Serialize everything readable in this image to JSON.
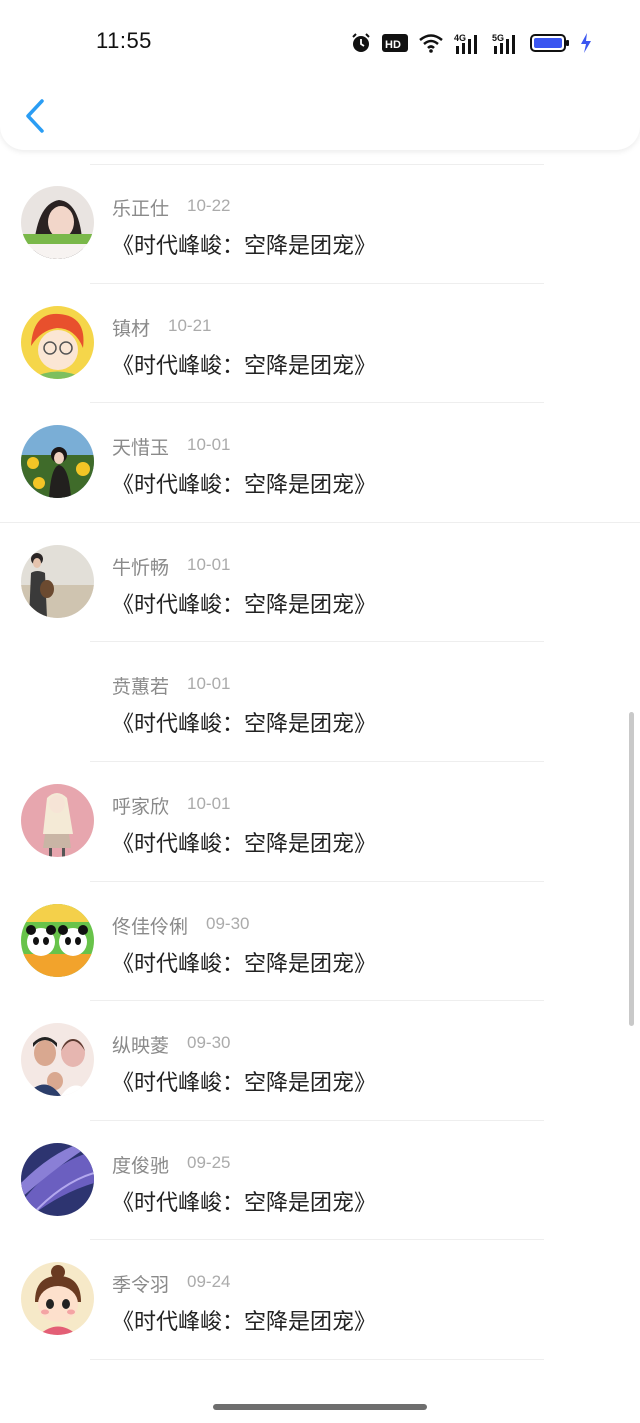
{
  "status_bar": {
    "time": "11:55",
    "icons": [
      "alarm-icon",
      "hd-icon",
      "wifi-icon",
      "signal-4g-icon",
      "signal-5g-icon",
      "battery-icon",
      "charging-icon"
    ],
    "hd_label": "HD",
    "net_4g": "4G",
    "net_5g": "5G"
  },
  "header": {
    "back_icon": "chevron-left-icon",
    "accent": "#2a9df4"
  },
  "items": [
    {
      "name": "乐正仕",
      "date": "10-22",
      "title": "《时代峰峻：空降是团宠》",
      "avatar": "avatar-girl-photo"
    },
    {
      "name": "镇材",
      "date": "10-21",
      "title": "《时代峰峻：空降是团宠》",
      "avatar": "avatar-redhair-cartoon"
    },
    {
      "name": "天惜玉",
      "date": "10-01",
      "title": "《时代峰峻：空降是团宠》",
      "avatar": "avatar-sunflower-girl"
    },
    {
      "name": "牛忻畅",
      "date": "10-01",
      "title": "《时代峰峻：空降是团宠》",
      "avatar": "avatar-beach-person"
    },
    {
      "name": "贲蕙若",
      "date": "10-01",
      "title": "《时代峰峻：空降是团宠》",
      "avatar": "avatar-empty"
    },
    {
      "name": "呼家欣",
      "date": "10-01",
      "title": "《时代峰峻：空降是团宠》",
      "avatar": "avatar-pink-drawing"
    },
    {
      "name": "佟佳伶俐",
      "date": "09-30",
      "title": "《时代峰峻：空降是团宠》",
      "avatar": "avatar-pandas"
    },
    {
      "name": "纵映菱",
      "date": "09-30",
      "title": "《时代峰峻：空降是团宠》",
      "avatar": "avatar-couple"
    },
    {
      "name": "度俊驰",
      "date": "09-25",
      "title": "《时代峰峻：空降是团宠》",
      "avatar": "avatar-purple-feather"
    },
    {
      "name": "季令羽",
      "date": "09-24",
      "title": "《时代峰峻：空降是团宠》",
      "avatar": "avatar-cartoon-girl"
    }
  ]
}
